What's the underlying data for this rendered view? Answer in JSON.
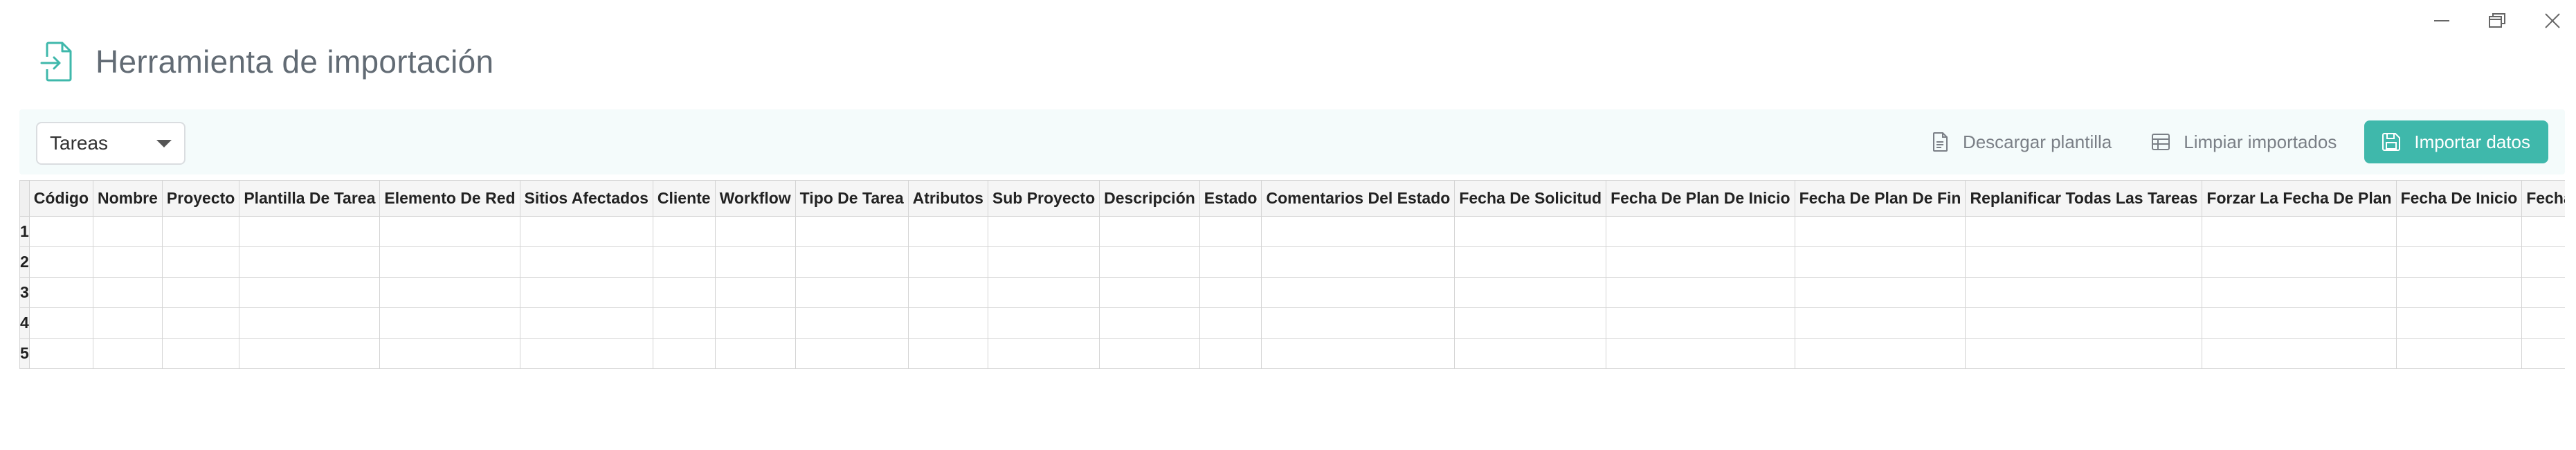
{
  "header": {
    "title": "Herramienta de importación"
  },
  "toolbar": {
    "select_value": "Tareas",
    "download_template_label": "Descargar plantilla",
    "clear_imported_label": "Limpiar importados",
    "import_data_label": "Importar datos"
  },
  "colors": {
    "accent": "#3fb8ab",
    "toolbar_bg": "#f4fbfb",
    "title": "#626b74"
  },
  "icons": {
    "app": "file-import-icon",
    "minimize": "minimize-icon",
    "restore": "restore-icon",
    "close": "close-icon",
    "download": "file-download-icon",
    "clear": "table-icon",
    "import": "save-icon",
    "select_arrow": "caret-down-icon"
  },
  "grid": {
    "columns": [
      "Código",
      "Nombre",
      "Proyecto",
      "Plantilla De Tarea",
      "Elemento De Red",
      "Sitios Afectados",
      "Cliente",
      "Workflow",
      "Tipo De Tarea",
      "Atributos",
      "Sub Proyecto",
      "Descripción",
      "Estado",
      "Comentarios Del Estado",
      "Fecha De Solicitud",
      "Fecha De Plan De Inicio",
      "Fecha De Plan De Fin",
      "Replanificar Todas Las Tareas",
      "Forzar La Fecha De Plan",
      "Fecha De Inicio",
      "Fecha"
    ],
    "rows": [
      "1",
      "2",
      "3",
      "4",
      "5"
    ]
  }
}
